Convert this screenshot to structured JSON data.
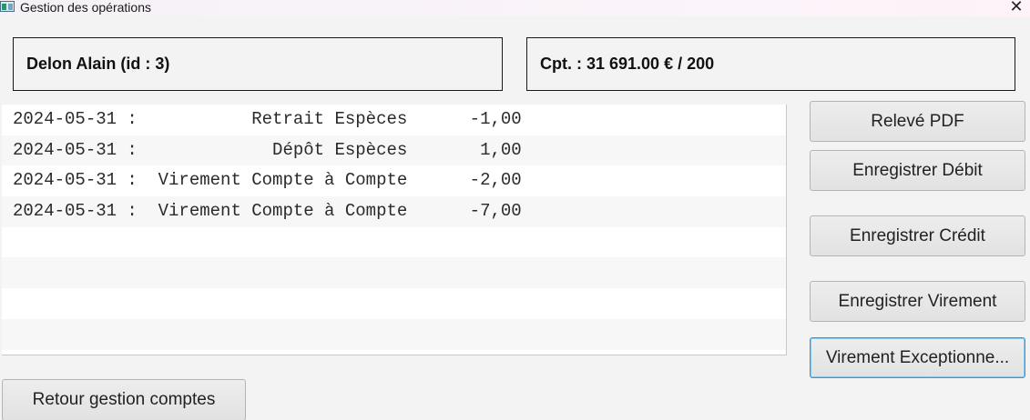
{
  "window": {
    "title": "Gestion des opérations",
    "close_symbol": "✕"
  },
  "info": {
    "client": "Delon Alain (id : 3)",
    "account": "Cpt. : 31  691.00 € / 200"
  },
  "operations": [
    "2024-05-31 :           Retrait Espèces      -1,00",
    "2024-05-31 :             Dépôt Espèces       1,00",
    "2024-05-31 :  Virement Compte à Compte      -2,00",
    "2024-05-31 :  Virement Compte à Compte      -7,00",
    "",
    "",
    "",
    ""
  ],
  "buttons": {
    "releve_pdf": "Relevé PDF",
    "enregistrer_debit": "Enregistrer Débit",
    "enregistrer_credit": "Enregistrer Crédit",
    "enregistrer_virement": "Enregistrer Virement",
    "virement_exceptionnel": "Virement Exceptionne...",
    "retour": "Retour gestion comptes"
  }
}
